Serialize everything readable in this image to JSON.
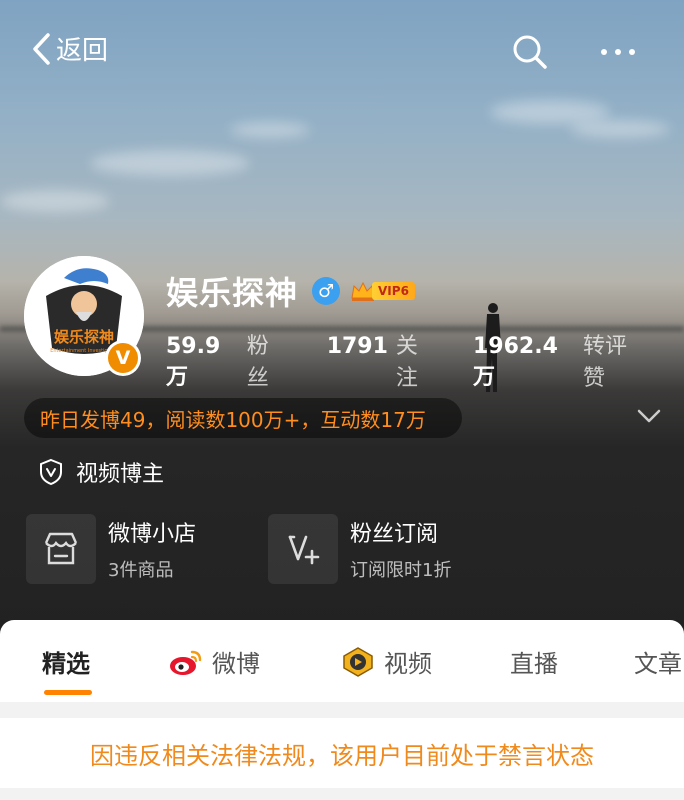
{
  "header": {
    "back_label": "返回"
  },
  "profile": {
    "name": "娱乐探神",
    "gender_symbol": "♂",
    "vip_label": "VIP6",
    "verified_symbol": "V",
    "avatar_text": "娱乐探神",
    "avatar_subtext": "Entertainment Investigator"
  },
  "stats": [
    {
      "value": "59.9万",
      "label": "粉丝"
    },
    {
      "value": "1791",
      "label": "关注"
    },
    {
      "value": "1962.4万",
      "label": "转评赞"
    }
  ],
  "summary": "昨日发博49，阅读数100万+，互动数17万",
  "role_label": "视频博主",
  "cards": {
    "shop": {
      "title": "微博小店",
      "subtitle": "3件商品"
    },
    "subscribe": {
      "title": "粉丝订阅",
      "subtitle": "订阅限时1折"
    }
  },
  "tabs": [
    {
      "label": "精选",
      "active": true
    },
    {
      "label": "微博",
      "icon": "weibo-icon"
    },
    {
      "label": "视频",
      "icon": "video-icon"
    },
    {
      "label": "直播"
    },
    {
      "label": "文章"
    }
  ],
  "notice": "因违反相关法律法规，该用户目前处于禁言状态",
  "colors": {
    "accent": "#ff8200",
    "notice": "#f08a1c",
    "summary_text": "#ff8d1f",
    "gender": "#3aa0ef"
  }
}
